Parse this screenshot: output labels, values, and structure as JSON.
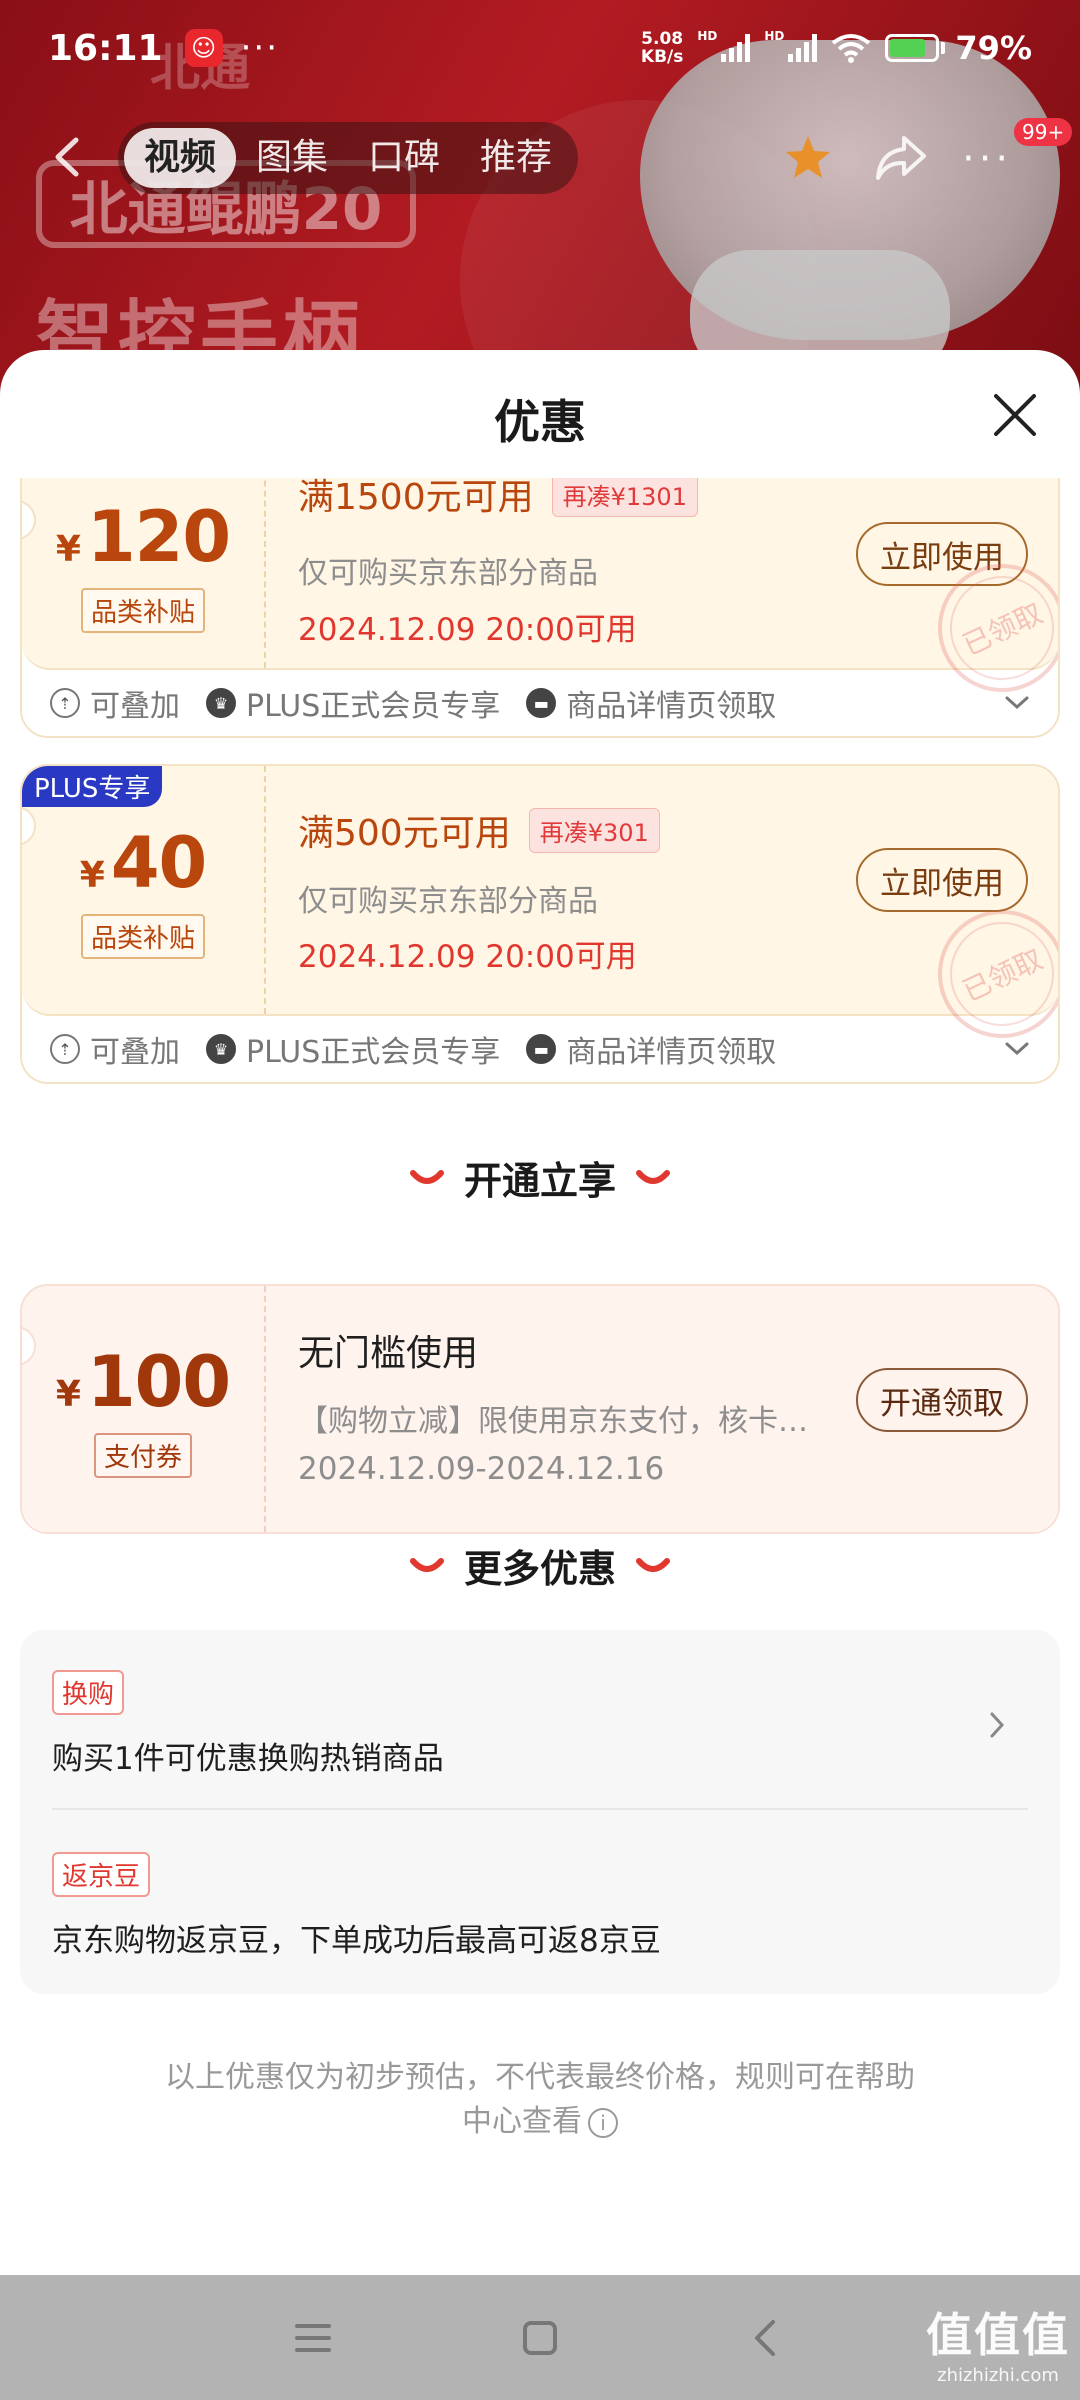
{
  "status_bar": {
    "time": "16:11",
    "dots": "···",
    "net_speed_value": "5.08",
    "net_speed_unit": "KB/s",
    "hd1": "HD",
    "hd2": "HD",
    "battery": "79%"
  },
  "hero": {
    "logo_text": "北通",
    "brand_box": "北通鲲鹏20",
    "title": "智控手柄"
  },
  "product_nav": {
    "tabs": [
      "视频",
      "图集",
      "口碑",
      "推荐"
    ],
    "active_tab": "视频",
    "more_badge": "99+"
  },
  "sheet": {
    "title": "优惠",
    "coupons": [
      {
        "amount": "120",
        "currency": "¥",
        "tag": "品类补贴",
        "condition": "满1500元可用",
        "extra": "再凑¥1301",
        "scope": "仅可购买京东部分商品",
        "validity": "2024.12.09 20:00可用",
        "button": "立即使用",
        "stamp": "已领取",
        "footer": [
          "可叠加",
          "PLUS正式会员专享",
          "商品详情页领取"
        ]
      },
      {
        "badge": "PLUS专享",
        "amount": "40",
        "currency": "¥",
        "tag": "品类补贴",
        "condition": "满500元可用",
        "extra": "再凑¥301",
        "scope": "仅可购买京东部分商品",
        "validity": "2024.12.09 20:00可用",
        "button": "立即使用",
        "stamp": "已领取",
        "footer": [
          "可叠加",
          "PLUS正式会员专享",
          "商品详情页领取"
        ]
      }
    ],
    "open_section": {
      "heading": "开通立享",
      "coupon": {
        "amount": "100",
        "currency": "¥",
        "tag": "支付券",
        "condition": "无门槛使用",
        "scope": "【购物立减】限使用京东支付，核卡…",
        "validity": "2024.12.09-2024.12.16",
        "button": "开通领取"
      }
    },
    "more_section": {
      "heading": "更多优惠",
      "items": [
        {
          "tag": "换购",
          "text": "购买1件可优惠换购热销商品"
        },
        {
          "tag": "返京豆",
          "text": "京东购物返京豆，下单成功后最高可返8京豆"
        }
      ]
    },
    "disclaimer_line1": "以上优惠仅为初步预估，不代表最终价格，规则可在帮助",
    "disclaimer_line2": "中心查看"
  },
  "watermark": {
    "big": "值值值",
    "small": "zhizhizhi.com"
  },
  "colors": {
    "accent_orange": "#b8460d",
    "accent_red": "#e0372e",
    "plus_blue": "#2a39c4",
    "coupon_bg": "#fff6e6"
  },
  "icons": [
    "back-arrow-icon",
    "star-icon",
    "share-icon",
    "more-icon",
    "close-icon",
    "chevron-down-icon",
    "chevron-right-icon",
    "info-icon",
    "menu-icon",
    "home-icon",
    "back-icon"
  ]
}
